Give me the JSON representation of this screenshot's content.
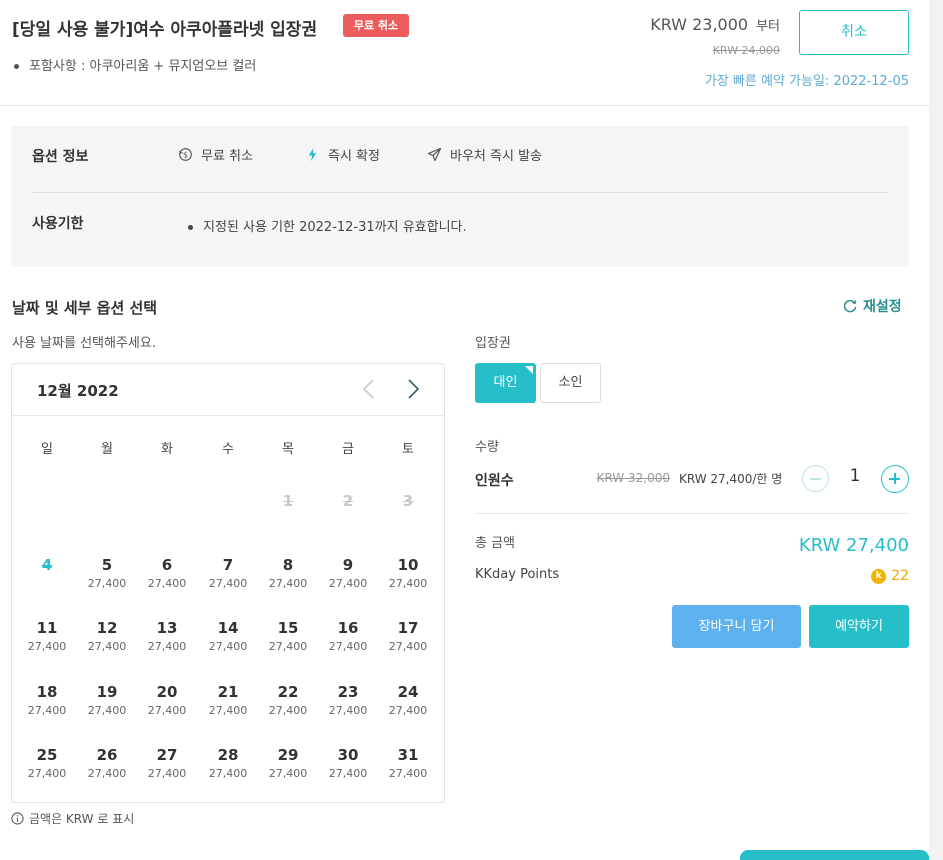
{
  "header": {
    "title": "[당일 사용 불가]여수 아쿠아플라넷 입장권",
    "badge": "무료 취소",
    "includes": "포함사항 : 아쿠아리움 + 뮤지엄오브 컬러",
    "price_from": "KRW 23,000",
    "price_from_suffix": "부터",
    "price_original": "KRW 24,000",
    "cancel_label": "취소",
    "earliest_date": "가장 빠른 예약 가능일: 2022-12-05"
  },
  "option_info": {
    "label": "옵션 정보",
    "features": [
      {
        "label": "무료 취소",
        "icon": "refund-icon"
      },
      {
        "label": "즉시 확정",
        "icon": "lightning-icon"
      },
      {
        "label": "바우처 즉시 발송",
        "icon": "send-icon"
      }
    ],
    "validity_label": "사용기한",
    "validity_text": "지정된 사용 기한 2022-12-31까지 유효합니다."
  },
  "selection": {
    "title": "날짜 및 세부 옵션 선택",
    "reset": "재설정",
    "date_instruction": "사용 날짜를 선택해주세요.",
    "currency_note": "금액은 KRW 로 표시"
  },
  "calendar": {
    "month_label": "12월 2022",
    "weekdays": [
      "일",
      "월",
      "화",
      "수",
      "목",
      "금",
      "토"
    ],
    "weeks": [
      [
        null,
        null,
        null,
        null,
        {
          "day": "1",
          "state": "disabled"
        },
        {
          "day": "2",
          "state": "disabled"
        },
        {
          "day": "3",
          "state": "disabled"
        }
      ],
      [
        {
          "day": "4",
          "state": "today"
        },
        {
          "day": "5",
          "price": "27,400"
        },
        {
          "day": "6",
          "price": "27,400"
        },
        {
          "day": "7",
          "price": "27,400"
        },
        {
          "day": "8",
          "price": "27,400"
        },
        {
          "day": "9",
          "price": "27,400"
        },
        {
          "day": "10",
          "price": "27,400"
        }
      ],
      [
        {
          "day": "11",
          "price": "27,400"
        },
        {
          "day": "12",
          "price": "27,400"
        },
        {
          "day": "13",
          "price": "27,400"
        },
        {
          "day": "14",
          "price": "27,400"
        },
        {
          "day": "15",
          "price": "27,400"
        },
        {
          "day": "16",
          "price": "27,400"
        },
        {
          "day": "17",
          "price": "27,400"
        }
      ],
      [
        {
          "day": "18",
          "price": "27,400"
        },
        {
          "day": "19",
          "price": "27,400"
        },
        {
          "day": "20",
          "price": "27,400"
        },
        {
          "day": "21",
          "price": "27,400"
        },
        {
          "day": "22",
          "price": "27,400"
        },
        {
          "day": "23",
          "price": "27,400"
        },
        {
          "day": "24",
          "price": "27,400"
        }
      ],
      [
        {
          "day": "25",
          "price": "27,400"
        },
        {
          "day": "26",
          "price": "27,400"
        },
        {
          "day": "27",
          "price": "27,400"
        },
        {
          "day": "28",
          "price": "27,400"
        },
        {
          "day": "29",
          "price": "27,400"
        },
        {
          "day": "30",
          "price": "27,400"
        },
        {
          "day": "31",
          "price": "27,400"
        }
      ]
    ]
  },
  "ticket": {
    "label": "입장권",
    "options": [
      "대인",
      "소인"
    ],
    "selected": "대인"
  },
  "quantity": {
    "label": "수량",
    "row_label": "인원수",
    "original_price": "KRW 32,000",
    "unit_price": "KRW 27,400/한 명",
    "value": "1"
  },
  "total": {
    "label": "총 금액",
    "value": "KRW 27,400",
    "points_label": "KKday Points",
    "points_value": "22",
    "points_coin": "k"
  },
  "actions": {
    "cart": "장바구니 담기",
    "book": "예약하기"
  },
  "colors": {
    "accent": "#26bec9",
    "badge_red": "#ec5c5c",
    "cart_blue": "#5eb1ef",
    "points_gold": "#f0a500"
  }
}
